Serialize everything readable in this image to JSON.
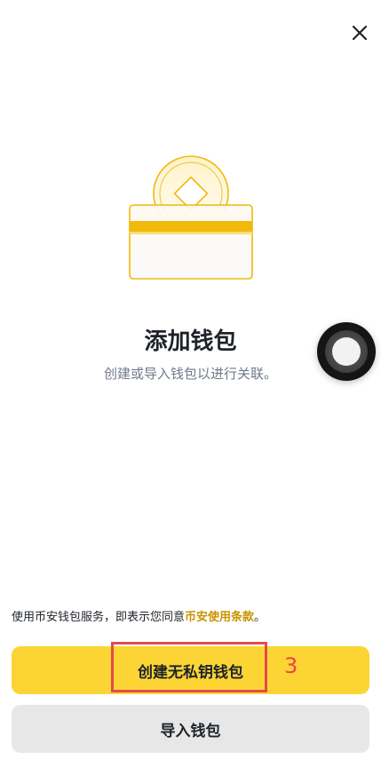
{
  "header": {
    "close_icon": "close-icon"
  },
  "illustration": {
    "icon": "wallet-coin-illustration",
    "accent": "#f0b90b"
  },
  "main": {
    "title": "添加钱包",
    "subtitle": "创建或导入钱包以进行关联。"
  },
  "floating_button": {
    "icon": "assistive-touch-icon"
  },
  "terms": {
    "prefix": "使用币安钱包服务，即表示您同意",
    "link": "币安使用条款",
    "suffix": "。"
  },
  "actions": {
    "create_label": "创建无私钥钱包",
    "import_label": "导入钱包"
  },
  "annotation": {
    "step_number": "3",
    "color": "#e24c4c"
  },
  "colors": {
    "primary": "#fcd535",
    "secondary": "#e7e7e7",
    "link": "#c99400",
    "text": "#1e2329",
    "muted": "#707a8a"
  }
}
